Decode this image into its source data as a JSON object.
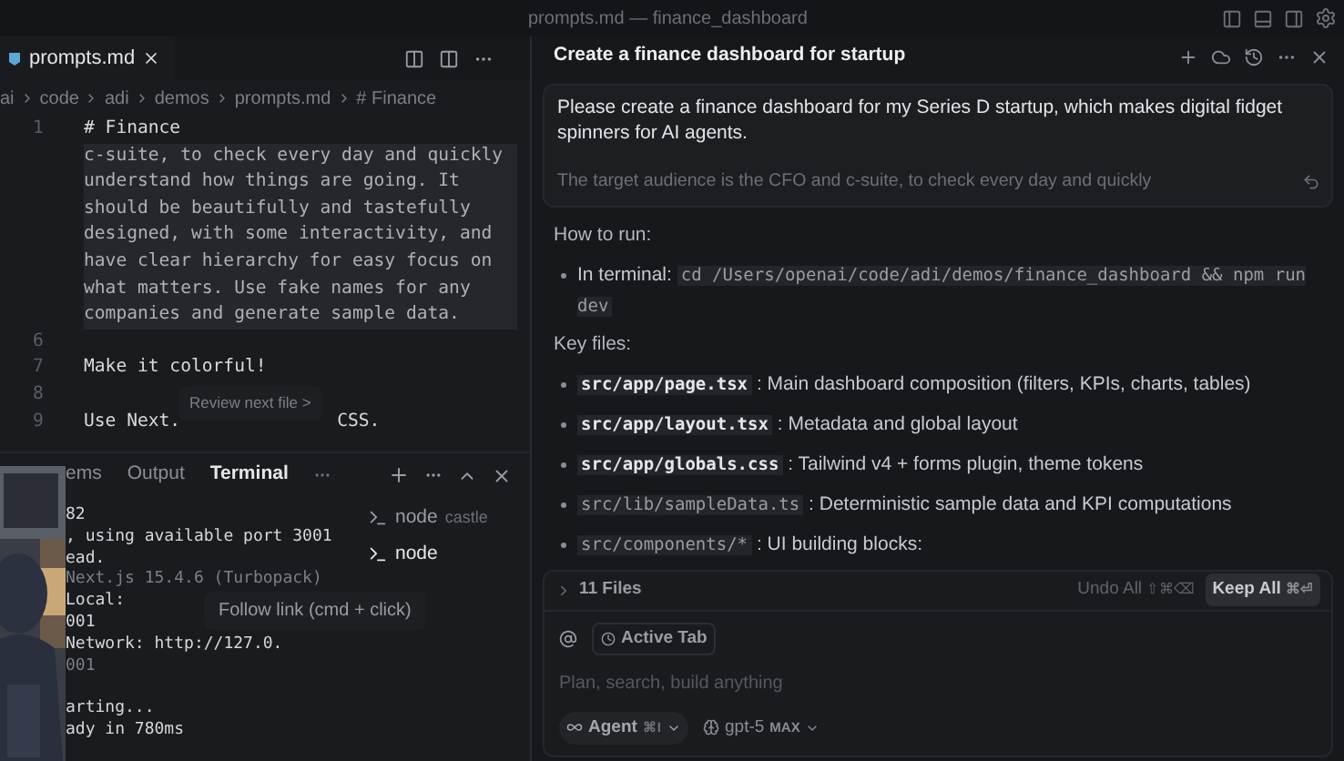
{
  "window": {
    "title": "prompts.md — finance_dashboard"
  },
  "editor": {
    "tab": {
      "label": "prompts.md",
      "selected": true
    },
    "breadcrumb": [
      "ai",
      "code",
      "adi",
      "demos",
      "prompts.md",
      "# Finance"
    ],
    "lines": [
      {
        "number": "1",
        "segments": [
          "# Finance"
        ],
        "highlighted": false,
        "bright": true
      },
      {
        "segments": [
          "c-suite, to check every day and quickly"
        ],
        "highlighted": true,
        "bright": false
      },
      {
        "segments": [
          "understand how things are going. It"
        ],
        "highlighted": true,
        "bright": false
      },
      {
        "segments": [
          "should be beautifully and tastefully"
        ],
        "highlighted": true,
        "bright": false
      },
      {
        "segments": [
          "designed, with some interactivity, and"
        ],
        "highlighted": true,
        "bright": false
      },
      {
        "segments": [
          "have clear hierarchy for easy focus on"
        ],
        "highlighted": true,
        "bright": false
      },
      {
        "segments": [
          "what matters.  Use fake names for any"
        ],
        "highlighted": true,
        "bright": false
      },
      {
        "segments": [
          "companies and generate sample data."
        ],
        "highlighted": true,
        "bright": false
      },
      {
        "number": "6",
        "highlighted": false
      },
      {
        "number": "7",
        "segments": [
          "Make it colorful!"
        ],
        "highlighted": false,
        "bright": true
      },
      {
        "number": "8",
        "highlighted": false
      },
      {
        "number": "9",
        "segments": [
          "Use Next.",
          "CSS."
        ],
        "highlighted": false,
        "bright": true
      }
    ],
    "tooltip": "Review next file >"
  },
  "panel": {
    "tabs": [
      {
        "label": "ems",
        "selected": false
      },
      {
        "label": "Output",
        "selected": false
      },
      {
        "label": "Terminal",
        "selected": true
      }
    ],
    "lines": [
      {
        "text": "82",
        "dim": false
      },
      {
        "text": ", using available port 3001",
        "dim": false
      },
      {
        "text": "ead.",
        "dim": false
      },
      {
        "text": "Next.js 15.4.6 (Turbopack)",
        "dim": true
      },
      {
        "text": "Local:",
        "dim": false
      },
      {
        "text": "001",
        "dim": false
      },
      {
        "text": "Network:      http://127.0.",
        "dim": false
      },
      {
        "text": "001",
        "dim": true
      },
      {
        "text": "arting...",
        "dim": false,
        "space_before": true
      },
      {
        "text": "ady in 780ms",
        "dim": false
      }
    ],
    "terminals": [
      {
        "name": "node",
        "detail": "castle",
        "selected": false
      },
      {
        "name": "node",
        "selected": true
      }
    ],
    "tooltip": "Follow link (cmd + click)"
  },
  "chat": {
    "title": "Create a finance dashboard for startup",
    "prompt": [
      "Please create a finance dashboard for my Series D startup, which makes digital fidget spinners for AI agents.",
      "The target audience is the CFO and c-suite, to check every day and quickly"
    ],
    "sections": [
      {
        "heading": "How to run:",
        "bullets": [
          {
            "label": "In terminal:",
            "code": "cd /Users/openai/code/adi/demos/finance_dashboard && npm run dev",
            "code_first": false
          }
        ]
      },
      {
        "heading": "Key files:",
        "bullets": [
          {
            "code": "src/app/page.tsx",
            "label": ": Main dashboard composition (filters, KPIs, charts, tables)",
            "code_first": true
          },
          {
            "code": "src/app/layout.tsx",
            "label": ": Metadata and global layout",
            "code_first": true
          },
          {
            "code": "src/app/globals.css",
            "label": ": Tailwind v4 + forms plugin, theme tokens",
            "code_first": true
          },
          {
            "code": "src/lib/sampleData.ts",
            "label": ": Deterministic sample data and KPI computations",
            "code_first": true
          },
          {
            "code": "src/components/*",
            "label": ": UI building blocks:",
            "code_first": true
          }
        ]
      }
    ],
    "files": {
      "label": "11 Files",
      "undo": "Undo All",
      "undo_keys": "⇧⌘⌫",
      "keep": "Keep All",
      "keep_keys": "⌘⏎"
    },
    "composer": {
      "context": "Active Tab",
      "placeholder": "Plan, search, build anything",
      "mode": "Agent",
      "mode_keys": "⌘I",
      "model": "gpt-5",
      "model_tag": "MAX"
    }
  }
}
